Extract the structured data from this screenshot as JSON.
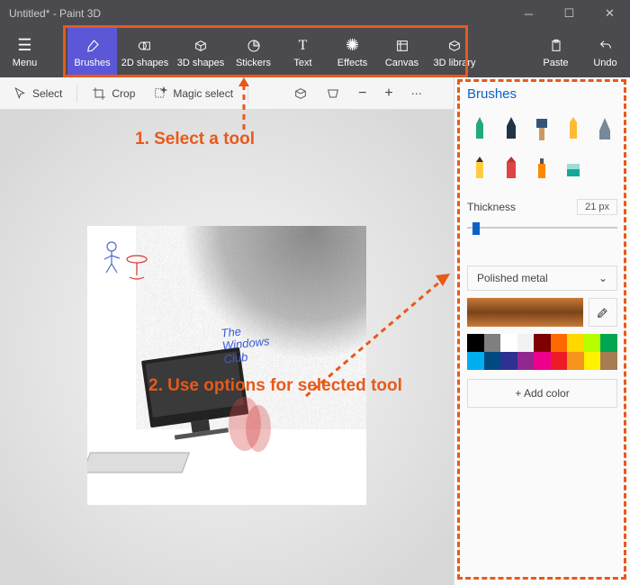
{
  "title": "Untitled* - Paint 3D",
  "ribbon": {
    "menu": "Menu",
    "items": [
      {
        "label": "Brushes",
        "icon": "brush"
      },
      {
        "label": "2D shapes",
        "icon": "square"
      },
      {
        "label": "3D shapes",
        "icon": "cube"
      },
      {
        "label": "Stickers",
        "icon": "sticker"
      },
      {
        "label": "Text",
        "icon": "text"
      },
      {
        "label": "Effects",
        "icon": "sparkle"
      },
      {
        "label": "Canvas",
        "icon": "canvas"
      },
      {
        "label": "3D library",
        "icon": "library"
      }
    ],
    "paste": "Paste",
    "undo": "Undo"
  },
  "toolbar": {
    "select": "Select",
    "crop": "Crop",
    "magic": "Magic select"
  },
  "side": {
    "title": "Brushes",
    "thickness_label": "Thickness",
    "thickness_value": "21 px",
    "material": "Polished metal",
    "add_color": "+  Add color",
    "palette": [
      "#000000",
      "#7f7f7f",
      "#ffffff",
      "#f2f2f2",
      "#7f0000",
      "#ff6a00",
      "#ffd800",
      "#b6ff00",
      "#00a651",
      "#00aeef",
      "#004a80",
      "#2e3192",
      "#92278f",
      "#ec008c",
      "#ed1c24",
      "#f7941d",
      "#fff200",
      "#a67c52"
    ]
  },
  "annotations": {
    "step1": "1. Select a tool",
    "step2": "2. Use options for selected tool"
  },
  "canvas_text": {
    "l1": "The",
    "l2": "Windows",
    "l3": "Club"
  }
}
